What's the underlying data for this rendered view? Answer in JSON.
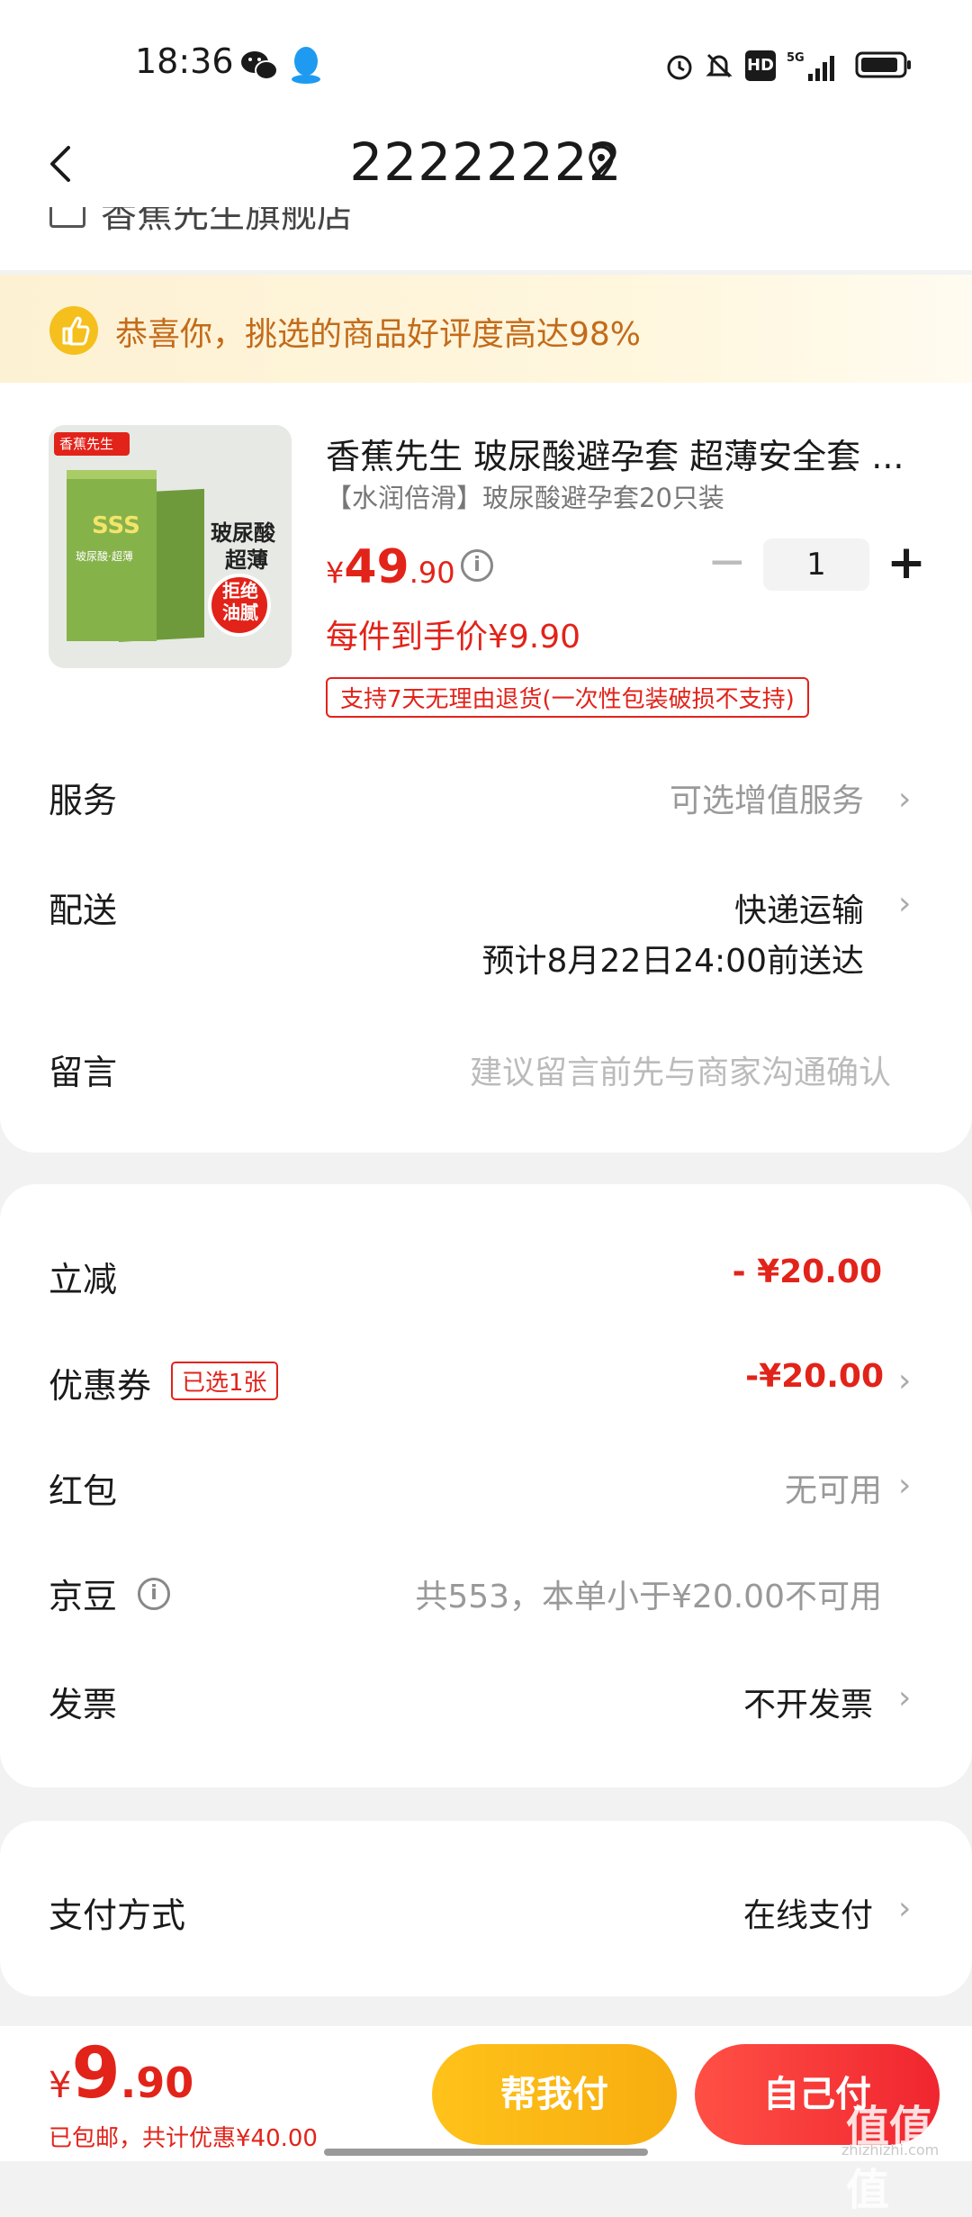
{
  "status_bar": {
    "time": "18:36",
    "battery_icon": "battery-icon",
    "signal": "5G"
  },
  "header": {
    "title": "22222222"
  },
  "store": {
    "name": "香蕉先生旗舰店"
  },
  "banner": {
    "text": "恭喜你，挑选的商品好评度高达98%"
  },
  "product": {
    "title": "香蕉先生 玻尿酸避孕套 超薄安全套 ...",
    "spec": "【水润倍滑】玻尿酸避孕套20只装",
    "price_symbol": "¥",
    "price_int": "49",
    "price_dec": ".90",
    "quantity": "1",
    "unit_price": "每件到手价¥9.90",
    "return_policy": "支持7天无理由退货(一次性包装破损不支持)",
    "image_texts": {
      "brand": "香蕉先生",
      "label1": "玻尿酸",
      "label2": "超薄",
      "badge": "拒绝\n油腻"
    }
  },
  "rows": {
    "service": {
      "label": "服务",
      "value": "可选增值服务"
    },
    "delivery": {
      "label": "配送",
      "value": "快递运输",
      "eta": "预计8月22日24:00前送达"
    },
    "message": {
      "label": "留言",
      "placeholder": "建议留言前先与商家沟通确认"
    }
  },
  "discounts": {
    "instant": {
      "label": "立减",
      "value": "- ¥20.00"
    },
    "coupon": {
      "label": "优惠券",
      "tag": "已选1张",
      "value": "-¥20.00"
    },
    "redpacket": {
      "label": "红包",
      "value": "无可用"
    },
    "jingdou": {
      "label": "京豆",
      "value": "共553，本单小于¥20.00不可用"
    },
    "invoice": {
      "label": "发票",
      "value": "不开发票"
    }
  },
  "payment": {
    "label": "支付方式",
    "value": "在线支付"
  },
  "bottom": {
    "yen": "¥",
    "total_int": "9",
    "total_dec": ".90",
    "note": "已包邮，共计优惠¥40.00",
    "help_pay": "帮我付",
    "self_pay": "自己付"
  },
  "watermark": {
    "text": "值值值",
    "url": "zhizhizhi.com"
  },
  "colors": {
    "accent_red": "#e2231a",
    "yellow": "#f7ad0f",
    "banner_text": "#c36b1a"
  }
}
